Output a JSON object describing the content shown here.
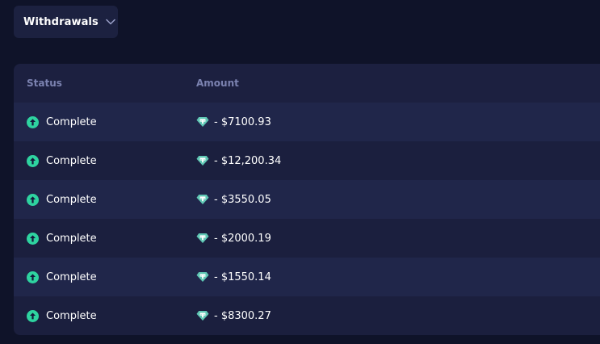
{
  "filter": {
    "label": "Withdrawals"
  },
  "table": {
    "headers": {
      "status": "Status",
      "amount": "Amount"
    },
    "rows": [
      {
        "status": "Complete",
        "amount": "- $7100.93"
      },
      {
        "status": "Complete",
        "amount": "- $12,200.34"
      },
      {
        "status": "Complete",
        "amount": "- $3550.05"
      },
      {
        "status": "Complete",
        "amount": "- $2000.19"
      },
      {
        "status": "Complete",
        "amount": "- $1550.14"
      },
      {
        "status": "Complete",
        "amount": "- $8300.27"
      }
    ]
  },
  "colors": {
    "background": "#0f1329",
    "panel": "#1c2040",
    "status_complete": "#2ed3a0",
    "coin": "#5fc7b4",
    "header_text": "#7b82b0"
  },
  "icons": {
    "status": "arrow-up-circle-icon",
    "coin": "tether-coin-icon",
    "dropdown": "chevron-down-icon"
  }
}
